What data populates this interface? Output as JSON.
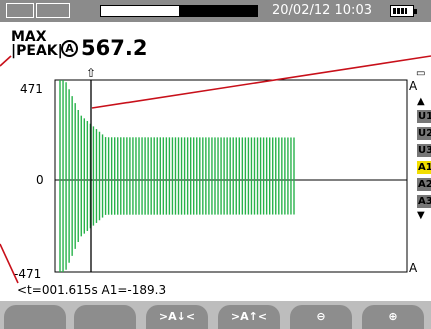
{
  "statusbar": {
    "datetime": "20/02/12 10:03",
    "icons": [
      "waveform-icon",
      "waveform-2-icon",
      "battery-icon"
    ],
    "progress_fraction": 0.5
  },
  "header": {
    "mode_line1": "MAX",
    "mode_line2": "|PEAK|",
    "channel_badge": "A",
    "peak_value": "567.2"
  },
  "chart_data": {
    "type": "line",
    "ylim": [
      -471,
      471
    ],
    "yticks": [
      "471",
      "0",
      "-471"
    ],
    "cursor_marker": "⇧",
    "samples_approx": 78,
    "description_points": [
      {
        "t": 0,
        "a1": -471
      },
      {
        "t": 0.05,
        "a1": 471
      },
      {
        "t": 0.2,
        "a1": 300
      },
      {
        "t": 0.45,
        "a1": 190
      },
      {
        "t": 2.3,
        "a1": 189
      }
    ]
  },
  "cursor": {
    "readout": "<t=001.615s  A1=-189.3"
  },
  "channels": {
    "labels": [
      "U1",
      "U2",
      "U3",
      "A1",
      "A2",
      "A3"
    ],
    "active": "A1",
    "colors": {
      "active": "#f2de00",
      "inactive": "#777777"
    }
  },
  "fkeys": [
    "",
    "",
    ">A↓<",
    ">A↑<",
    "zoom-out-icon",
    "zoom-in-icon"
  ],
  "colors": {
    "trace": "#27b24a",
    "status_bar": "#8b8b8b"
  }
}
